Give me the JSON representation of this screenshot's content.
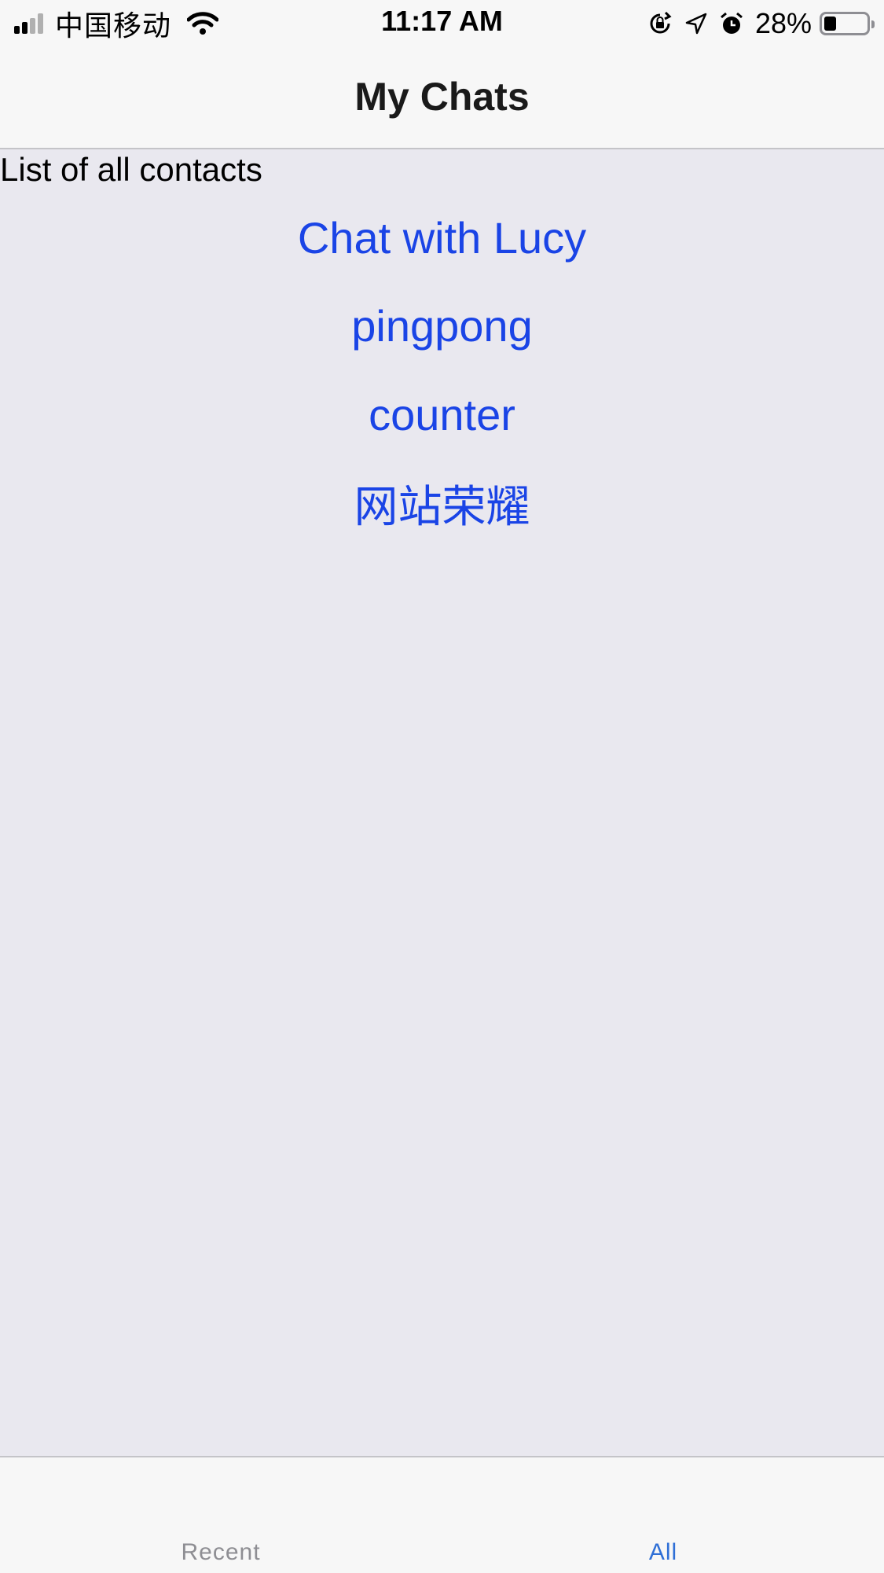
{
  "status_bar": {
    "carrier": "中国移动",
    "time": "11:17 AM",
    "battery_percent": "28%",
    "battery_level": 0.28,
    "icons": [
      "signal-icon",
      "wifi-icon",
      "orientation-lock-icon",
      "location-icon",
      "alarm-icon",
      "battery-icon"
    ]
  },
  "nav": {
    "title": "My Chats"
  },
  "content": {
    "caption": "List of all contacts",
    "contacts": [
      {
        "label": "Chat with Lucy"
      },
      {
        "label": "pingpong"
      },
      {
        "label": "counter"
      },
      {
        "label": "网站荣耀"
      }
    ]
  },
  "tab_bar": {
    "tabs": [
      {
        "label": "Recent",
        "selected": false
      },
      {
        "label": "All",
        "selected": true
      }
    ]
  },
  "colors": {
    "link": "#1a44e6",
    "tab_active": "#2f6fd6",
    "tab_inactive": "#8e8e93",
    "background": "#e9e8ef",
    "bar": "#f7f7f7"
  }
}
